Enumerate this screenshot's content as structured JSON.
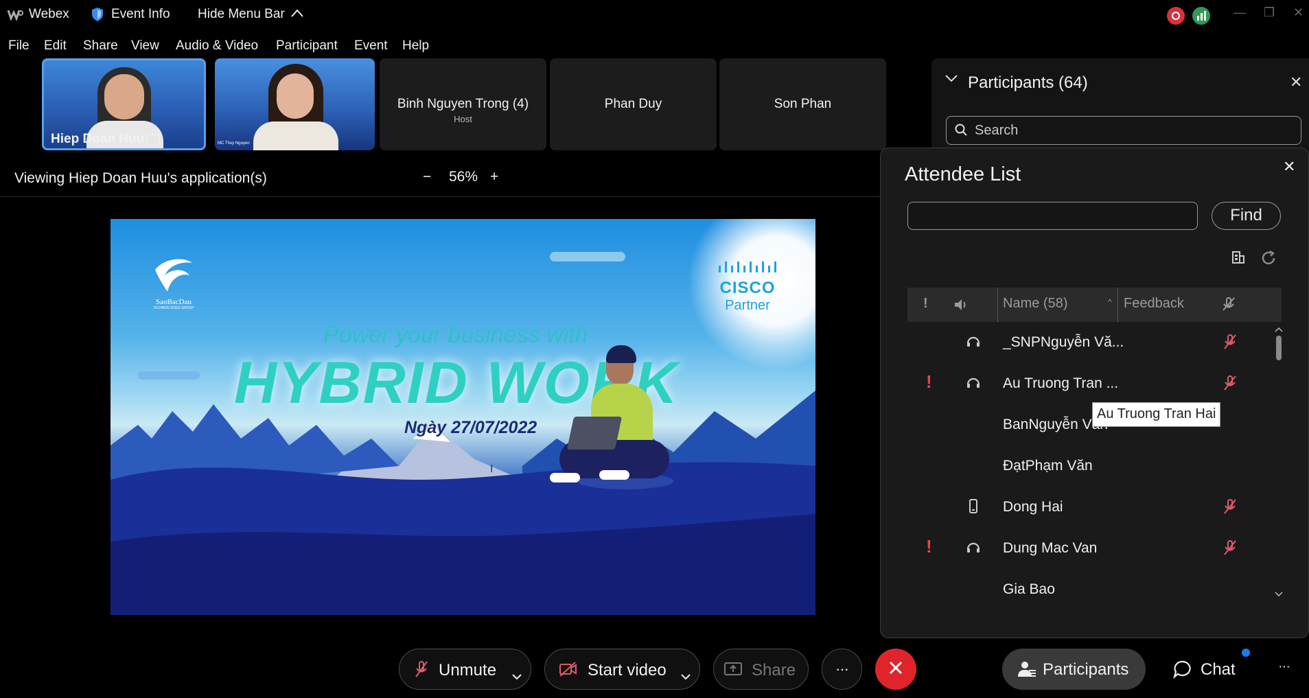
{
  "titlebar": {
    "app": "Webex",
    "event_info": "Event Info",
    "hide_menu": "Hide Menu Bar"
  },
  "menu": [
    "File",
    "Edit",
    "Share",
    "View",
    "Audio & Video",
    "Participant",
    "Event",
    "Help"
  ],
  "tiles": [
    {
      "name": "Hiep Doan Huu"
    },
    {
      "name": "MC Thuy Nguyen"
    },
    {
      "name": "Binh Nguyen Trong (4)",
      "sub": "Host"
    },
    {
      "name": "Phan Duy"
    },
    {
      "name": "Son Phan"
    }
  ],
  "share_bar": {
    "viewing": "Viewing Hiep Doan Huu's application(s)",
    "zoom": "56%"
  },
  "slide": {
    "logo_text": "SaoBacDau",
    "logo_sub": "TECHNOLOGIES GROUP",
    "cisco": "CISCO",
    "partner": "Partner",
    "tagline": "Power your business with",
    "headline": "HYBRID WORK",
    "date": "Ngày 27/07/2022"
  },
  "participants_panel": {
    "title": "Participants (64)",
    "search_placeholder": "Search"
  },
  "attendee_list": {
    "title": "Attendee List",
    "find": "Find",
    "col_name": "Name (58)",
    "col_feedback": "Feedback",
    "rows": [
      {
        "name": "_SNPNguyễn Vă...",
        "raised": false,
        "device": "headset",
        "muted": true
      },
      {
        "name": "Au Truong Tran ...",
        "raised": true,
        "device": "headset",
        "muted": true
      },
      {
        "name": "BanNguyễn Văn",
        "raised": false,
        "device": "",
        "muted": false
      },
      {
        "name": "ĐạtPhạm Văn",
        "raised": false,
        "device": "",
        "muted": false
      },
      {
        "name": "Dong Hai",
        "raised": false,
        "device": "phone",
        "muted": true
      },
      {
        "name": "Dung Mac Van",
        "raised": true,
        "device": "headset",
        "muted": true
      },
      {
        "name": "Gia Bao",
        "raised": false,
        "device": "",
        "muted": false
      }
    ],
    "tooltip": "Au Truong Tran Hai"
  },
  "toolbar": {
    "unmute": "Unmute",
    "start_video": "Start video",
    "share": "Share",
    "more": "···",
    "participants": "Participants",
    "chat": "Chat"
  },
  "colors": {
    "end_red": "#e0242b",
    "raise_red": "#e8474d",
    "mute_red": "#e25a6b",
    "accent_blue": "#1a7cf0"
  }
}
